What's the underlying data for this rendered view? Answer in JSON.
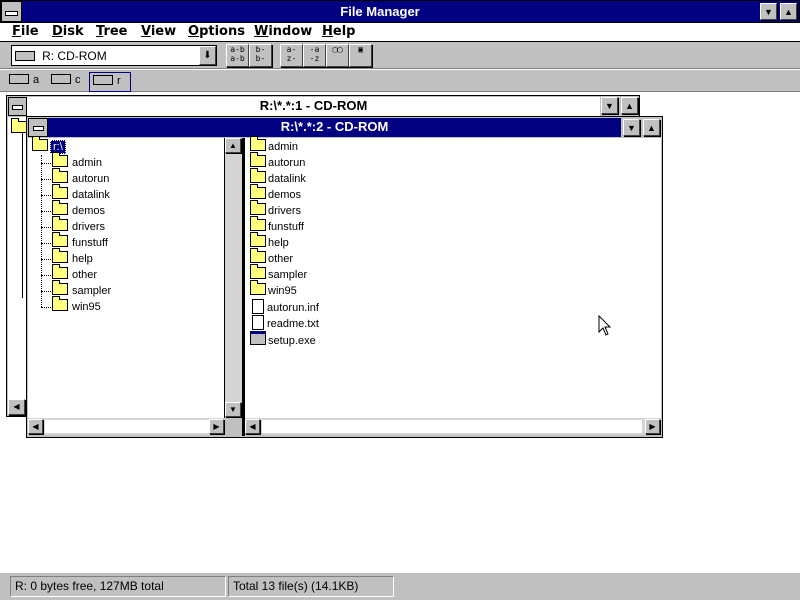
{
  "app": {
    "title": "File Manager"
  },
  "menu": [
    "File",
    "Disk",
    "Tree",
    "View",
    "Options",
    "Window",
    "Help"
  ],
  "toolbar": {
    "drive_selector": "R: CD-ROM",
    "buttons": [
      "connect-network-drive",
      "disconnect-network-drive",
      "share-as",
      "stop-sharing",
      "view-by-name",
      "view-by-details",
      "copy",
      "move"
    ]
  },
  "drives": [
    {
      "letter": "a",
      "icon": "floppy-drive-icon"
    },
    {
      "letter": "c",
      "icon": "hard-drive-icon"
    },
    {
      "letter": "r",
      "icon": "cdrom-drive-icon"
    }
  ],
  "windows": {
    "back": {
      "title": "R:\\*.*:1 - CD-ROM"
    },
    "front": {
      "title": "R:\\*.*:2 - CD-ROM",
      "tree_root": "r:\\",
      "tree_folders": [
        "admin",
        "autorun",
        "datalink",
        "demos",
        "drivers",
        "funstuff",
        "help",
        "other",
        "sampler",
        "win95"
      ],
      "contents": [
        {
          "name": "admin",
          "type": "folder"
        },
        {
          "name": "autorun",
          "type": "folder"
        },
        {
          "name": "datalink",
          "type": "folder"
        },
        {
          "name": "demos",
          "type": "folder"
        },
        {
          "name": "drivers",
          "type": "folder"
        },
        {
          "name": "funstuff",
          "type": "folder"
        },
        {
          "name": "help",
          "type": "folder"
        },
        {
          "name": "other",
          "type": "folder"
        },
        {
          "name": "sampler",
          "type": "folder"
        },
        {
          "name": "win95",
          "type": "folder"
        },
        {
          "name": "autorun.inf",
          "type": "file"
        },
        {
          "name": "readme.txt",
          "type": "file"
        },
        {
          "name": "setup.exe",
          "type": "exe"
        }
      ]
    }
  },
  "status": {
    "disk": "R: 0 bytes free,  127MB total",
    "files": "Total 13 file(s) (14.1KB)"
  }
}
